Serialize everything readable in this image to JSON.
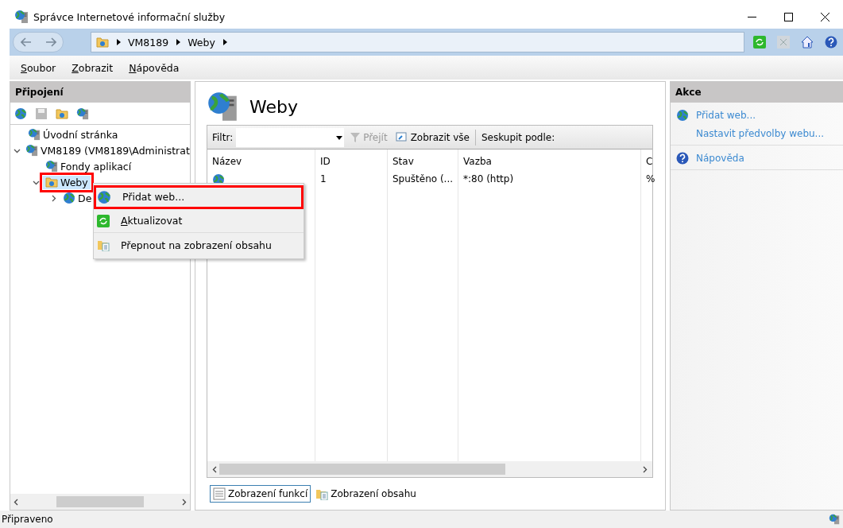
{
  "window": {
    "title": "Správce Internetové informační služby"
  },
  "address_bar": {
    "crumbs": [
      "VM8189",
      "Weby"
    ]
  },
  "menu_bar": [
    "Soubor",
    "Zobrazit",
    "Nápověda"
  ],
  "connections": {
    "title": "Připojení",
    "tree": [
      {
        "label": "Úvodní stránka",
        "kind": "server",
        "selected": false,
        "highlighted": false
      },
      {
        "label": "VM8189 (VM8189\\Administrat",
        "kind": "server",
        "selected": false,
        "highlighted": false,
        "expanded": true,
        "children": [
          {
            "label": "Fondy aplikací",
            "kind": "pool",
            "selected": false,
            "highlighted": false
          },
          {
            "label": "Weby",
            "kind": "folder",
            "selected": true,
            "highlighted": true,
            "expanded": true,
            "children": [
              {
                "label": "De",
                "kind": "globe",
                "selected": false,
                "highlighted": false,
                "expanded": false
              }
            ]
          }
        ]
      }
    ]
  },
  "content": {
    "title": "Weby",
    "filter": {
      "label": "Filtr:",
      "go": "Přejít",
      "show_all": "Zobrazit vše",
      "group_by": "Seskupit podle:"
    },
    "columns": [
      "Název",
      "ID",
      "Stav",
      "Vazba",
      "C"
    ],
    "rows": [
      {
        "cells": [
          "",
          "1",
          "Spuštěno (...",
          "*:80 (http)",
          "%"
        ]
      }
    ]
  },
  "view_tabs": [
    {
      "label": "Zobrazení funkcí",
      "selected": true
    },
    {
      "label": "Zobrazení obsahu",
      "selected": false
    }
  ],
  "context_menu": [
    {
      "label": "Přidat web...",
      "kind": "add",
      "highlighted": true
    },
    {
      "label": "Aktualizovat",
      "kind": "refresh",
      "highlighted": false
    },
    {
      "label": "Přepnout na zobrazení obsahu",
      "kind": "content",
      "highlighted": false
    }
  ],
  "actions": {
    "title": "Akce",
    "groups": [
      [
        {
          "label": "Přidat web...",
          "kind": "add"
        },
        {
          "label": "Nastavit předvolby webu...",
          "kind": "none"
        }
      ],
      [
        {
          "label": "Nápověda",
          "kind": "help"
        }
      ]
    ]
  },
  "status_bar": "Připraveno"
}
